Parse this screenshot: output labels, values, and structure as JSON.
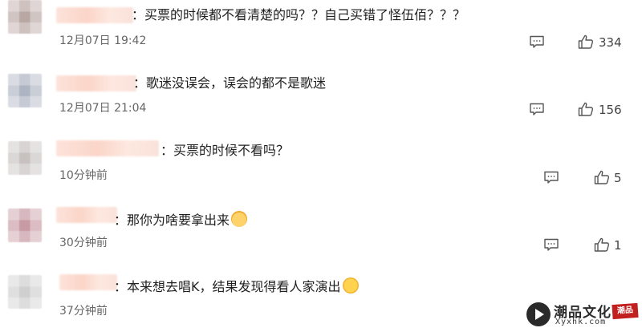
{
  "comments": [
    {
      "text": "：买票的时候都不看清楚的吗？？自己买错了怪伍佰？？？",
      "time": "12月07日 19:42",
      "likes": "334",
      "avatar_color": "#b9a7a3",
      "reply_icon": "comment-icon",
      "like_icon": "thumbs-up-icon"
    },
    {
      "text": "：歌迷没误会，误会的都不是歌迷",
      "time": "12月07日 21:04",
      "likes": "156",
      "avatar_color": "#aeb4c2",
      "reply_icon": "comment-icon",
      "like_icon": "thumbs-up-icon"
    },
    {
      "text": "：买票的时候不看吗？",
      "time": "10分钟前",
      "likes": "5",
      "avatar_color": "#c7c2c0",
      "reply_icon": "comment-icon",
      "like_icon": "thumbs-up-icon"
    },
    {
      "text": "：那你为啥要拿出来",
      "emoji": "cat-emoji",
      "time": "30分钟前",
      "likes": "1",
      "avatar_color": "#c89aa3",
      "reply_icon": "comment-icon",
      "like_icon": "thumbs-up-icon"
    },
    {
      "text": "：本来想去唱K，结果发现得看人家演出",
      "emoji": "laughing-emoji",
      "time": "37分钟前",
      "avatar_color": "#cfcfcf"
    }
  ],
  "watermark": {
    "name": "潮品文化",
    "url": "Xyxhk.com",
    "seal": "潮品",
    "seal_color": "#c21f1f",
    "icon": "play-icon"
  }
}
